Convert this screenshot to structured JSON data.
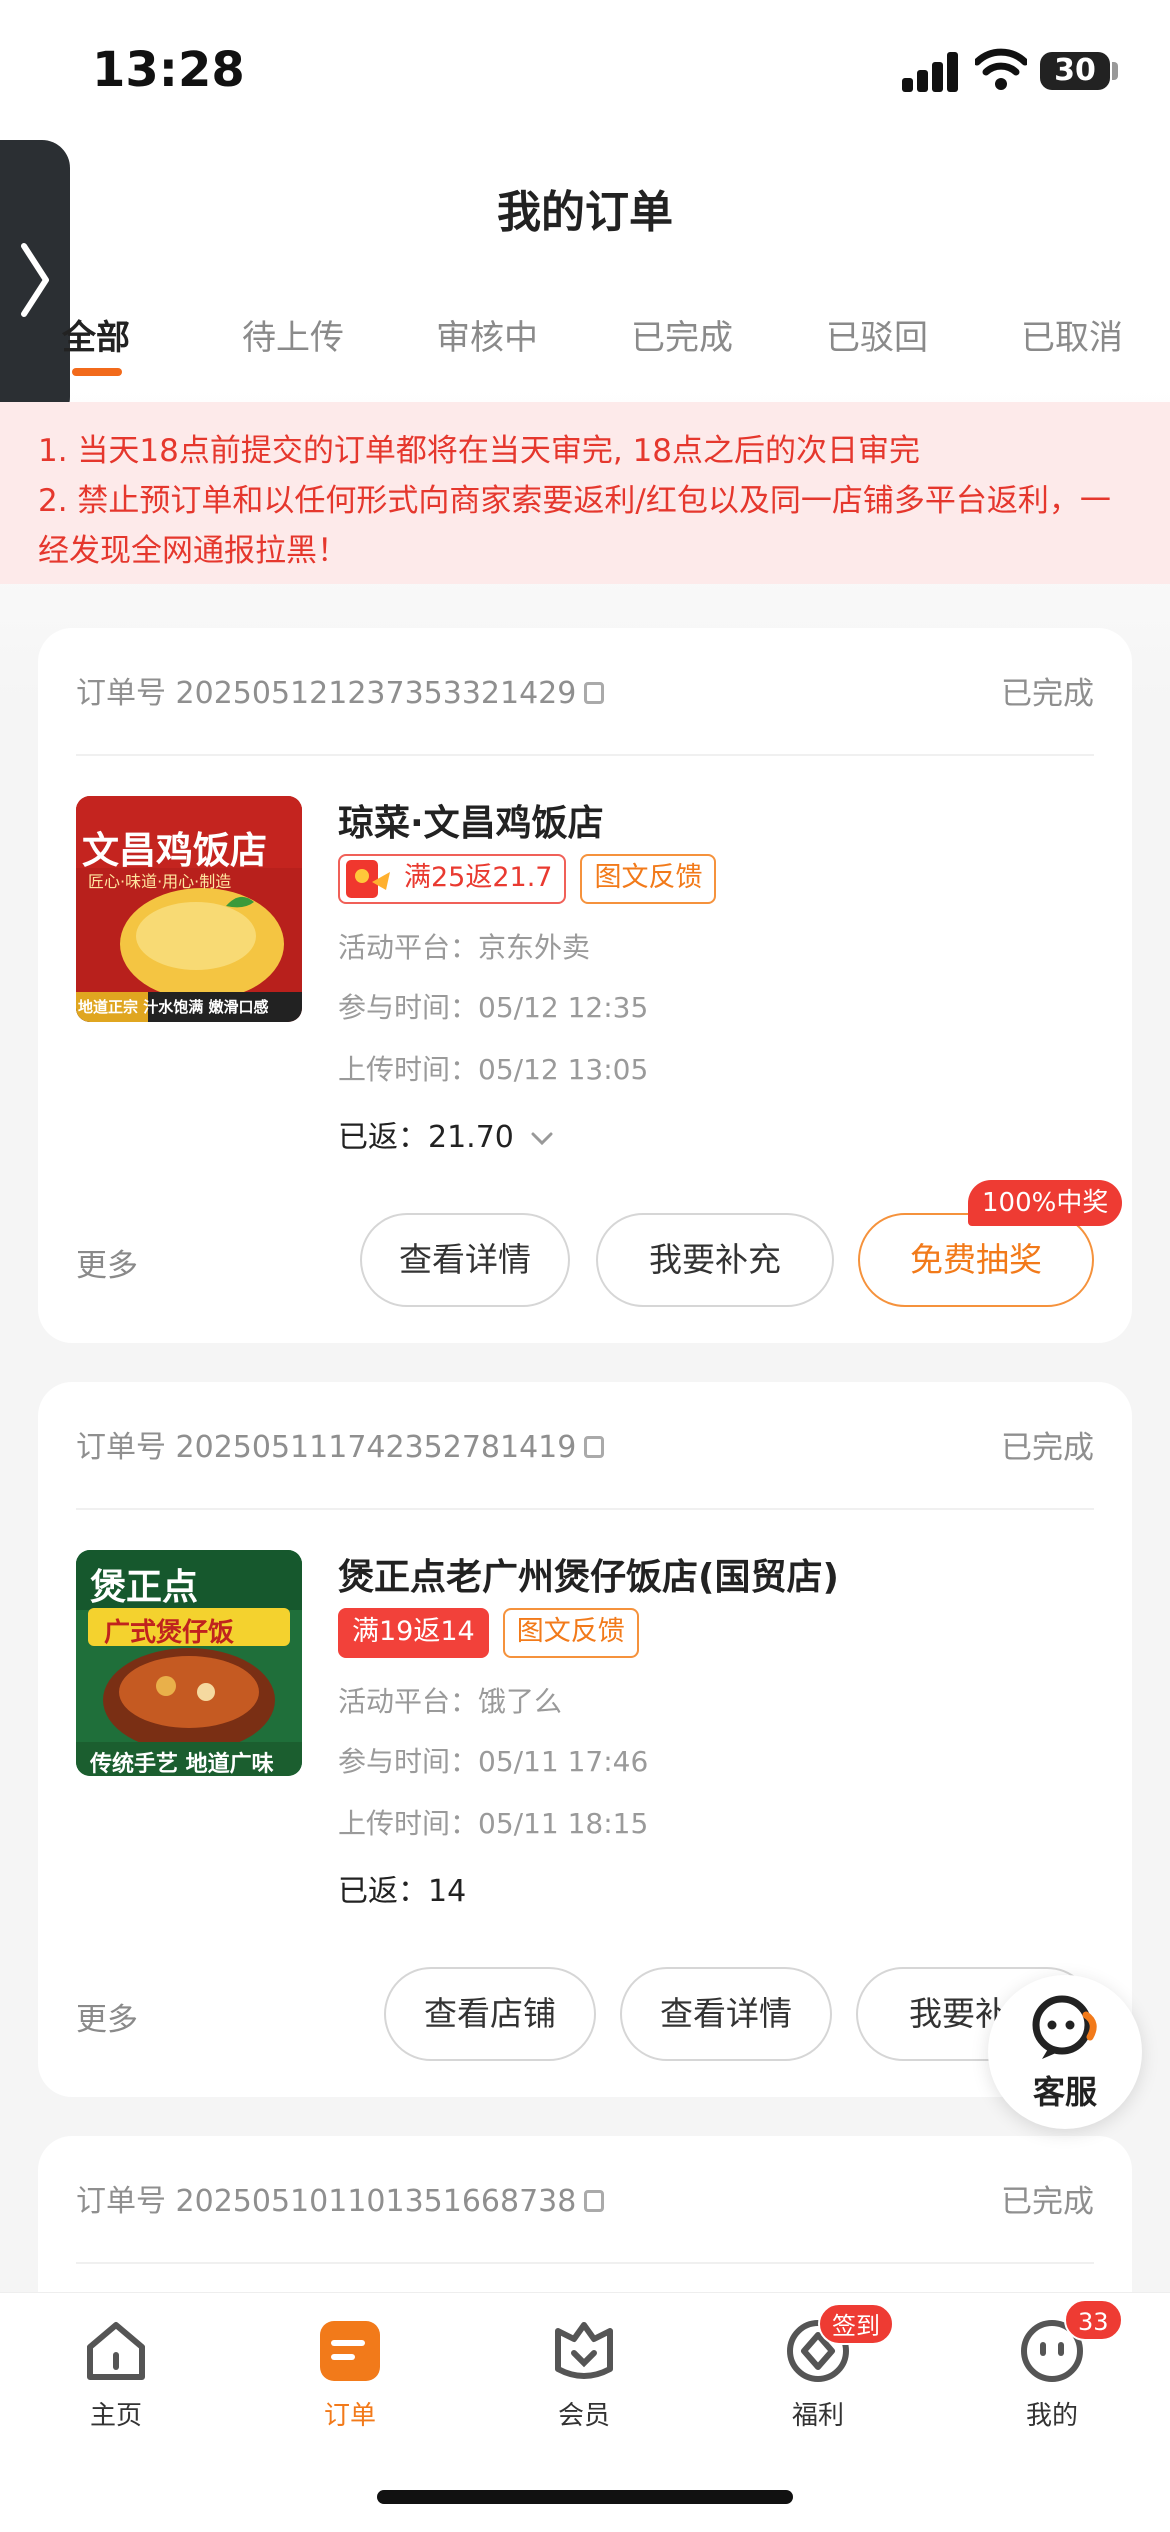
{
  "status_bar": {
    "time": "13:28",
    "battery": "30"
  },
  "header": {
    "title": "我的订单"
  },
  "tabs": [
    {
      "label": "全部",
      "active": true
    },
    {
      "label": "待上传"
    },
    {
      "label": "审核中"
    },
    {
      "label": "已完成"
    },
    {
      "label": "已驳回"
    },
    {
      "label": "已取消"
    }
  ],
  "notice": {
    "line1": "1. 当天18点前提交的订单都将在当天审完, 18点之后的次日审完",
    "line2a": "2. 禁止预订单和以任何形式向商家索要返利/红包以及同一店铺多平台返利，一",
    "line2b": "经发现全网通报拉黑！"
  },
  "orders": [
    {
      "order_no": "订单号 20250512123735332142​9",
      "status": "已完成",
      "shop_name": "琼菜·文昌鸡饭店",
      "thumb_text_top": "文昌鸡饭店",
      "thumb_text_sub": "匠心·味道·用心·制造",
      "thumb_text_bottom": "地道正宗 汁水饱满 嫩滑口感",
      "tag_offer": "满25返21.7",
      "tag_feedback": "图文反馈",
      "platform": "活动平台：京东外卖",
      "join_time": "参与时间：05/12 12:35",
      "upload_time": "上传时间：05/12 13:05",
      "refund": "已返：21.70",
      "more": "更多",
      "buttons": [
        "查看详情",
        "我要补充",
        "免费抽奖"
      ],
      "prize_badge": "100%中奖"
    },
    {
      "order_no": "订单号 2025051117423527814​19",
      "status": "已完成",
      "shop_name": "煲正点老广州煲仔饭店(国贸店)",
      "thumb_text_top": "煲正点",
      "thumb_text_sub": "广式煲仔饭",
      "thumb_text_bottom": "传统手艺 地道广味",
      "tag_offer": "满19返14",
      "tag_feedback": "图文反馈",
      "platform": "活动平台：饿了么",
      "join_time": "参与时间：05/11 17:46",
      "upload_time": "上传时间：05/11 18:15",
      "refund": "已返：14",
      "more": "更多",
      "buttons": [
        "查看店铺",
        "查看详情",
        "我要补充"
      ]
    },
    {
      "order_no": "订单号 2025051011013516687​38",
      "status": "已完成"
    }
  ],
  "service": {
    "label": "客服"
  },
  "bottom_nav": [
    {
      "label": "主页",
      "icon": "home-icon"
    },
    {
      "label": "订单",
      "icon": "order-icon",
      "active": true
    },
    {
      "label": "会员",
      "icon": "member-icon"
    },
    {
      "label": "福利",
      "icon": "welfare-icon",
      "badge": "签到"
    },
    {
      "label": "我的",
      "icon": "profile-icon",
      "badge": "33"
    }
  ],
  "colors": {
    "accent": "#f27a1a",
    "red": "#ee3b33"
  }
}
